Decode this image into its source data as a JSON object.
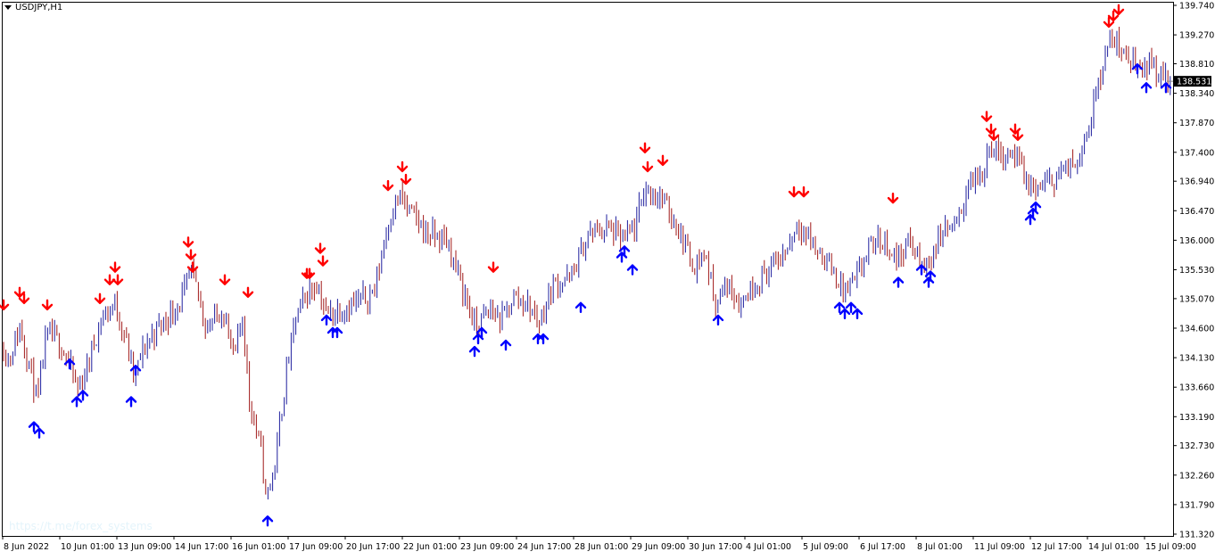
{
  "window": {
    "symbol_label": "USDJPY,H1",
    "watermark": "https://t.me/forex_systems",
    "current_price_label": "138.531"
  },
  "colors": {
    "background": "#ffffff",
    "frame": "#000000",
    "bar_up": "#1f1f9e",
    "bar_down": "#a01818",
    "arrow_up": "#0000ff",
    "arrow_down": "#ff0000",
    "price_tag_bg": "#000000",
    "price_tag_text": "#ffffff"
  },
  "chart_data": {
    "type": "ohlc_bar",
    "title": "USDJPY,H1",
    "ylim": [
      131.32,
      139.74
    ],
    "y_ticks": [
      "139.740",
      "139.270",
      "138.810",
      "138.340",
      "137.870",
      "137.400",
      "136.940",
      "136.470",
      "136.000",
      "135.530",
      "135.070",
      "134.600",
      "134.130",
      "133.660",
      "133.190",
      "132.730",
      "132.260",
      "131.790",
      "131.320"
    ],
    "x_ticks": [
      "8 Jun 2022",
      "10 Jun 01:00",
      "13 Jun 09:00",
      "14 Jun 17:00",
      "16 Jun 01:00",
      "17 Jun 09:00",
      "20 Jun 17:00",
      "22 Jun 01:00",
      "23 Jun 09:00",
      "24 Jun 17:00",
      "28 Jun 01:00",
      "29 Jun 09:00",
      "30 Jun 17:00",
      "4 Jul 01:00",
      "5 Jul 09:00",
      "6 Jul 17:00",
      "8 Jul 01:00",
      "11 Jul 09:00",
      "12 Jul 17:00",
      "14 Jul 01:00",
      "15 Jul 09:00"
    ],
    "price_path": [
      [
        0,
        134.4
      ],
      [
        10,
        134.1
      ],
      [
        22,
        134.6
      ],
      [
        32,
        134.1
      ],
      [
        42,
        133.4
      ],
      [
        52,
        134.5
      ],
      [
        66,
        134.4
      ],
      [
        78,
        134.0
      ],
      [
        88,
        133.6
      ],
      [
        100,
        134.1
      ],
      [
        112,
        134.7
      ],
      [
        128,
        135.0
      ],
      [
        140,
        134.5
      ],
      [
        150,
        133.8
      ],
      [
        162,
        134.3
      ],
      [
        176,
        134.6
      ],
      [
        190,
        134.8
      ],
      [
        205,
        135.1
      ],
      [
        215,
        135.5
      ],
      [
        232,
        134.6
      ],
      [
        250,
        134.9
      ],
      [
        262,
        134.1
      ],
      [
        272,
        134.8
      ],
      [
        280,
        133.4
      ],
      [
        292,
        132.7
      ],
      [
        298,
        131.9
      ],
      [
        308,
        132.4
      ],
      [
        320,
        133.8
      ],
      [
        332,
        134.8
      ],
      [
        346,
        135.2
      ],
      [
        356,
        135.3
      ],
      [
        366,
        134.8
      ],
      [
        380,
        134.9
      ],
      [
        400,
        135.0
      ],
      [
        420,
        135.2
      ],
      [
        435,
        136.3
      ],
      [
        448,
        136.7
      ],
      [
        462,
        136.4
      ],
      [
        480,
        136.1
      ],
      [
        500,
        136.0
      ],
      [
        515,
        135.4
      ],
      [
        522,
        135.1
      ],
      [
        533,
        134.6
      ],
      [
        550,
        134.9
      ],
      [
        562,
        134.7
      ],
      [
        575,
        135.1
      ],
      [
        590,
        135.0
      ],
      [
        605,
        134.7
      ],
      [
        620,
        135.3
      ],
      [
        640,
        135.4
      ],
      [
        660,
        136.1
      ],
      [
        680,
        136.2
      ],
      [
        700,
        136.0
      ],
      [
        712,
        136.2
      ],
      [
        722,
        136.8
      ],
      [
        740,
        136.7
      ],
      [
        760,
        136.2
      ],
      [
        778,
        135.6
      ],
      [
        790,
        135.8
      ],
      [
        802,
        135.0
      ],
      [
        815,
        135.3
      ],
      [
        830,
        135.0
      ],
      [
        845,
        135.3
      ],
      [
        860,
        135.5
      ],
      [
        880,
        135.8
      ],
      [
        895,
        136.3
      ],
      [
        912,
        135.9
      ],
      [
        930,
        135.6
      ],
      [
        945,
        135.2
      ],
      [
        958,
        135.3
      ],
      [
        975,
        135.9
      ],
      [
        992,
        136.0
      ],
      [
        1005,
        135.7
      ],
      [
        1020,
        136.0
      ],
      [
        1035,
        135.5
      ],
      [
        1045,
        135.8
      ],
      [
        1058,
        136.2
      ],
      [
        1072,
        136.2
      ],
      [
        1085,
        136.9
      ],
      [
        1100,
        137.0
      ],
      [
        1108,
        137.5
      ],
      [
        1122,
        137.4
      ],
      [
        1138,
        137.4
      ],
      [
        1150,
        136.9
      ],
      [
        1160,
        136.8
      ],
      [
        1175,
        136.9
      ],
      [
        1190,
        137.1
      ],
      [
        1205,
        137.2
      ],
      [
        1220,
        137.8
      ],
      [
        1232,
        138.6
      ],
      [
        1242,
        139.1
      ],
      [
        1252,
        139.2
      ],
      [
        1262,
        138.9
      ],
      [
        1278,
        138.8
      ],
      [
        1292,
        138.8
      ],
      [
        1303,
        138.6
      ],
      [
        1312,
        138.53
      ]
    ],
    "up_arrows": [
      [
        38,
        133.1
      ],
      [
        44,
        133.0
      ],
      [
        78,
        134.1
      ],
      [
        86,
        133.5
      ],
      [
        93,
        133.6
      ],
      [
        147,
        133.5
      ],
      [
        152,
        134.0
      ],
      [
        300,
        131.6
      ],
      [
        366,
        134.8
      ],
      [
        373,
        134.6
      ],
      [
        378,
        134.6
      ],
      [
        532,
        134.3
      ],
      [
        536,
        134.5
      ],
      [
        540,
        134.6
      ],
      [
        567,
        134.4
      ],
      [
        603,
        134.5
      ],
      [
        609,
        134.5
      ],
      [
        651,
        135.0
      ],
      [
        697,
        135.8
      ],
      [
        700,
        135.9
      ],
      [
        709,
        135.6
      ],
      [
        805,
        134.8
      ],
      [
        941,
        135.0
      ],
      [
        947,
        134.9
      ],
      [
        954,
        135.0
      ],
      [
        961,
        134.9
      ],
      [
        1007,
        135.4
      ],
      [
        1033,
        135.6
      ],
      [
        1041,
        135.4
      ],
      [
        1043,
        135.5
      ],
      [
        1155,
        136.4
      ],
      [
        1158,
        136.5
      ],
      [
        1161,
        136.6
      ],
      [
        1275,
        138.8
      ],
      [
        1285,
        138.5
      ],
      [
        1307,
        138.5
      ]
    ],
    "down_arrows": [
      [
        4,
        134.9
      ],
      [
        22,
        135.1
      ],
      [
        27,
        135.0
      ],
      [
        53,
        134.9
      ],
      [
        112,
        135.0
      ],
      [
        123,
        135.3
      ],
      [
        129,
        135.5
      ],
      [
        132,
        135.3
      ],
      [
        211,
        135.9
      ],
      [
        214,
        135.7
      ],
      [
        216,
        135.5
      ],
      [
        252,
        135.3
      ],
      [
        278,
        135.1
      ],
      [
        344,
        135.4
      ],
      [
        347,
        135.4
      ],
      [
        359,
        135.8
      ],
      [
        362,
        135.6
      ],
      [
        435,
        136.8
      ],
      [
        451,
        137.1
      ],
      [
        455,
        136.9
      ],
      [
        553,
        135.5
      ],
      [
        723,
        137.4
      ],
      [
        726,
        137.1
      ],
      [
        743,
        137.2
      ],
      [
        890,
        136.7
      ],
      [
        901,
        136.7
      ],
      [
        1001,
        136.6
      ],
      [
        1106,
        137.9
      ],
      [
        1111,
        137.7
      ],
      [
        1114,
        137.6
      ],
      [
        1138,
        137.7
      ],
      [
        1141,
        137.6
      ],
      [
        1243,
        139.4
      ],
      [
        1248,
        139.5
      ],
      [
        1254,
        139.6
      ]
    ]
  }
}
